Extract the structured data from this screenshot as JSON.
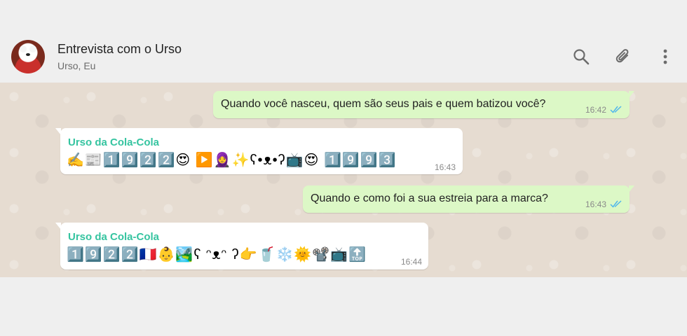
{
  "header": {
    "title": "Entrevista com o Urso",
    "subtitle": "Urso, Eu"
  },
  "icons": {
    "search": "search-icon",
    "attach": "paperclip-icon",
    "menu": "more-vertical-icon"
  },
  "colors": {
    "outgoing_bubble": "#dcf8c6",
    "incoming_bubble": "#ffffff",
    "sender_name": "#35c4a0",
    "read_ticks": "#4fb6ec"
  },
  "messages": [
    {
      "direction": "outgoing",
      "text": "Quando você nasceu, quem são seus pais e quem batizou você?",
      "time": "16:42",
      "status": "read"
    },
    {
      "direction": "incoming",
      "sender": "Urso da Cola-Cola",
      "text": "✍️📰1️⃣9️⃣2️⃣2️⃣😍 ▶️🧕✨ʕ•ᴥ•ʔ📺😍 1️⃣9️⃣9️⃣3️⃣",
      "time": "16:43"
    },
    {
      "direction": "outgoing",
      "text": "Quando e como foi a sua estreia para a marca?",
      "time": "16:43",
      "status": "read"
    },
    {
      "direction": "incoming",
      "sender": "Urso da Cola-Cola",
      "text": "1️⃣9️⃣2️⃣2️⃣🇫🇷👶🏞️ʕ ᵔᴥᵔ ʔ👉🥤❄️🌞📽️📺🔝",
      "time": "16:44"
    }
  ]
}
